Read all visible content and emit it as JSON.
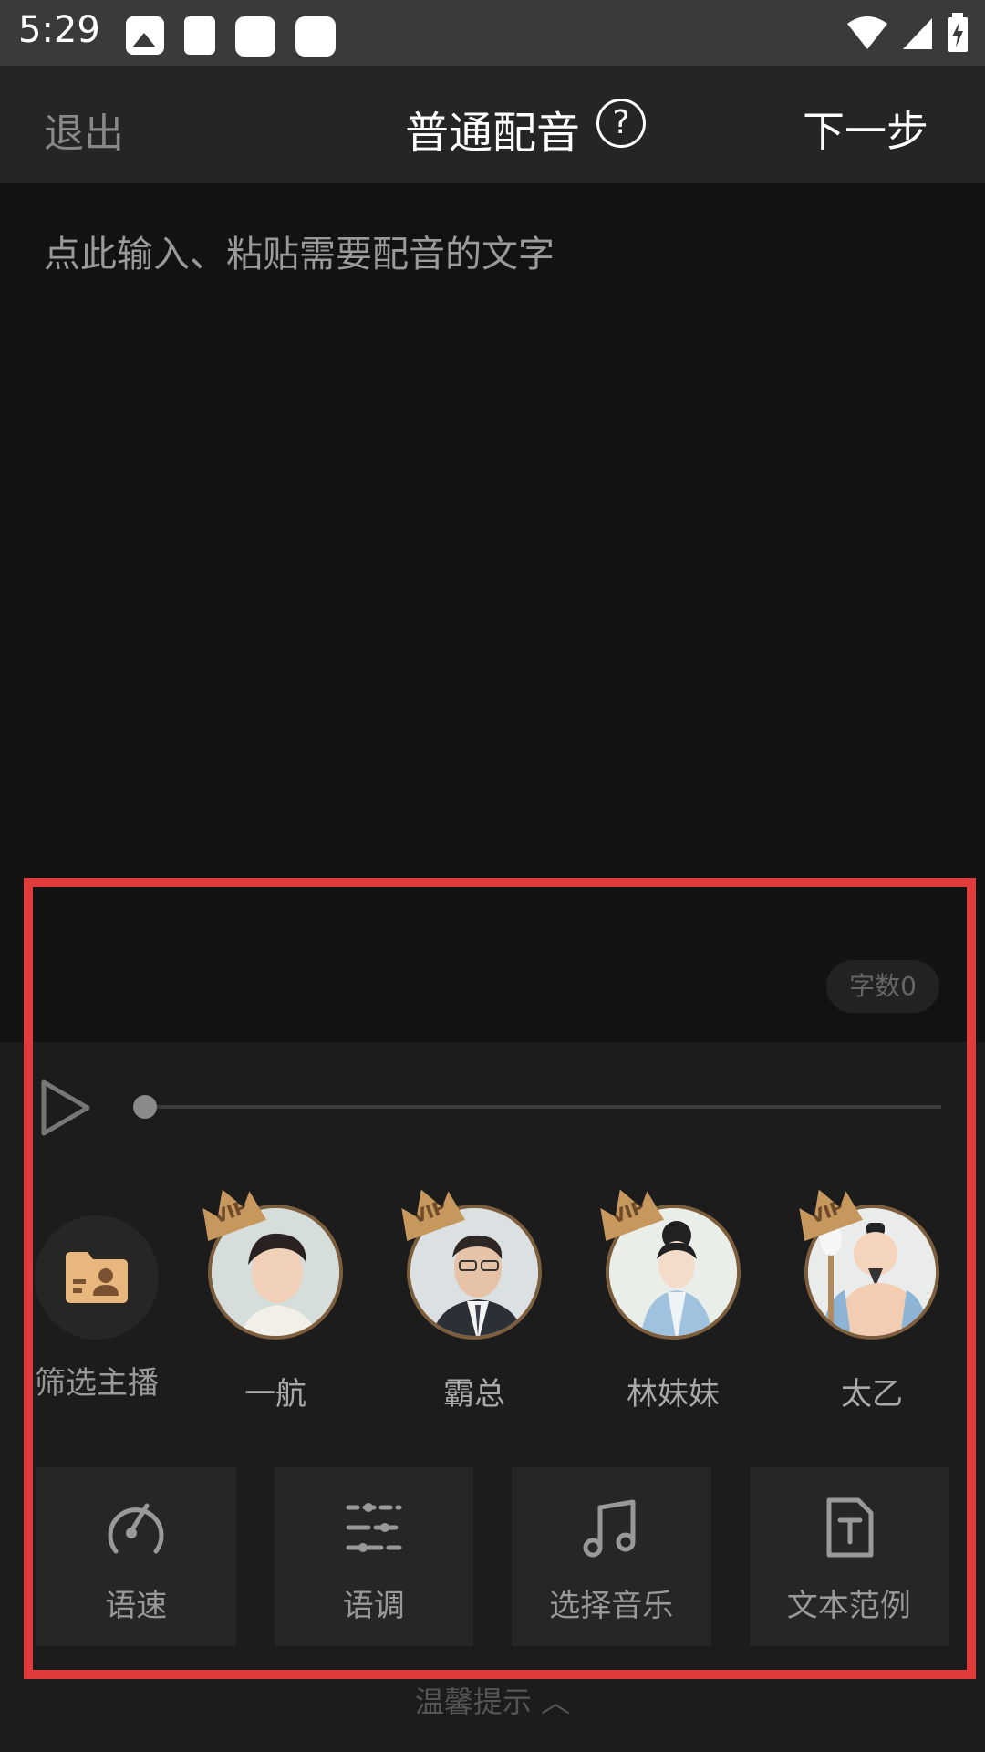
{
  "status_bar": {
    "time": "5:29"
  },
  "header": {
    "exit_label": "退出",
    "title": "普通配音",
    "next_label": "下一步"
  },
  "editor": {
    "placeholder": "点此输入、粘贴需要配音的文字",
    "char_count": "字数0"
  },
  "voices": {
    "filter_label": "筛选主播",
    "items": [
      {
        "name": "一航",
        "badge": "VIP"
      },
      {
        "name": "霸总",
        "badge": "VIP"
      },
      {
        "name": "林妹妹",
        "badge": "VIP"
      },
      {
        "name": "太乙",
        "badge": "VIP"
      }
    ]
  },
  "tools": [
    {
      "label": "语速",
      "icon": "speedometer-icon"
    },
    {
      "label": "语调",
      "icon": "sliders-icon"
    },
    {
      "label": "选择音乐",
      "icon": "music-note-icon"
    },
    {
      "label": "文本范例",
      "icon": "text-document-icon"
    }
  ],
  "footer": {
    "tip_label": "温馨提示 ︿"
  },
  "colors": {
    "highlight": "#e23b3b",
    "vip_badge": "#c7985e"
  }
}
